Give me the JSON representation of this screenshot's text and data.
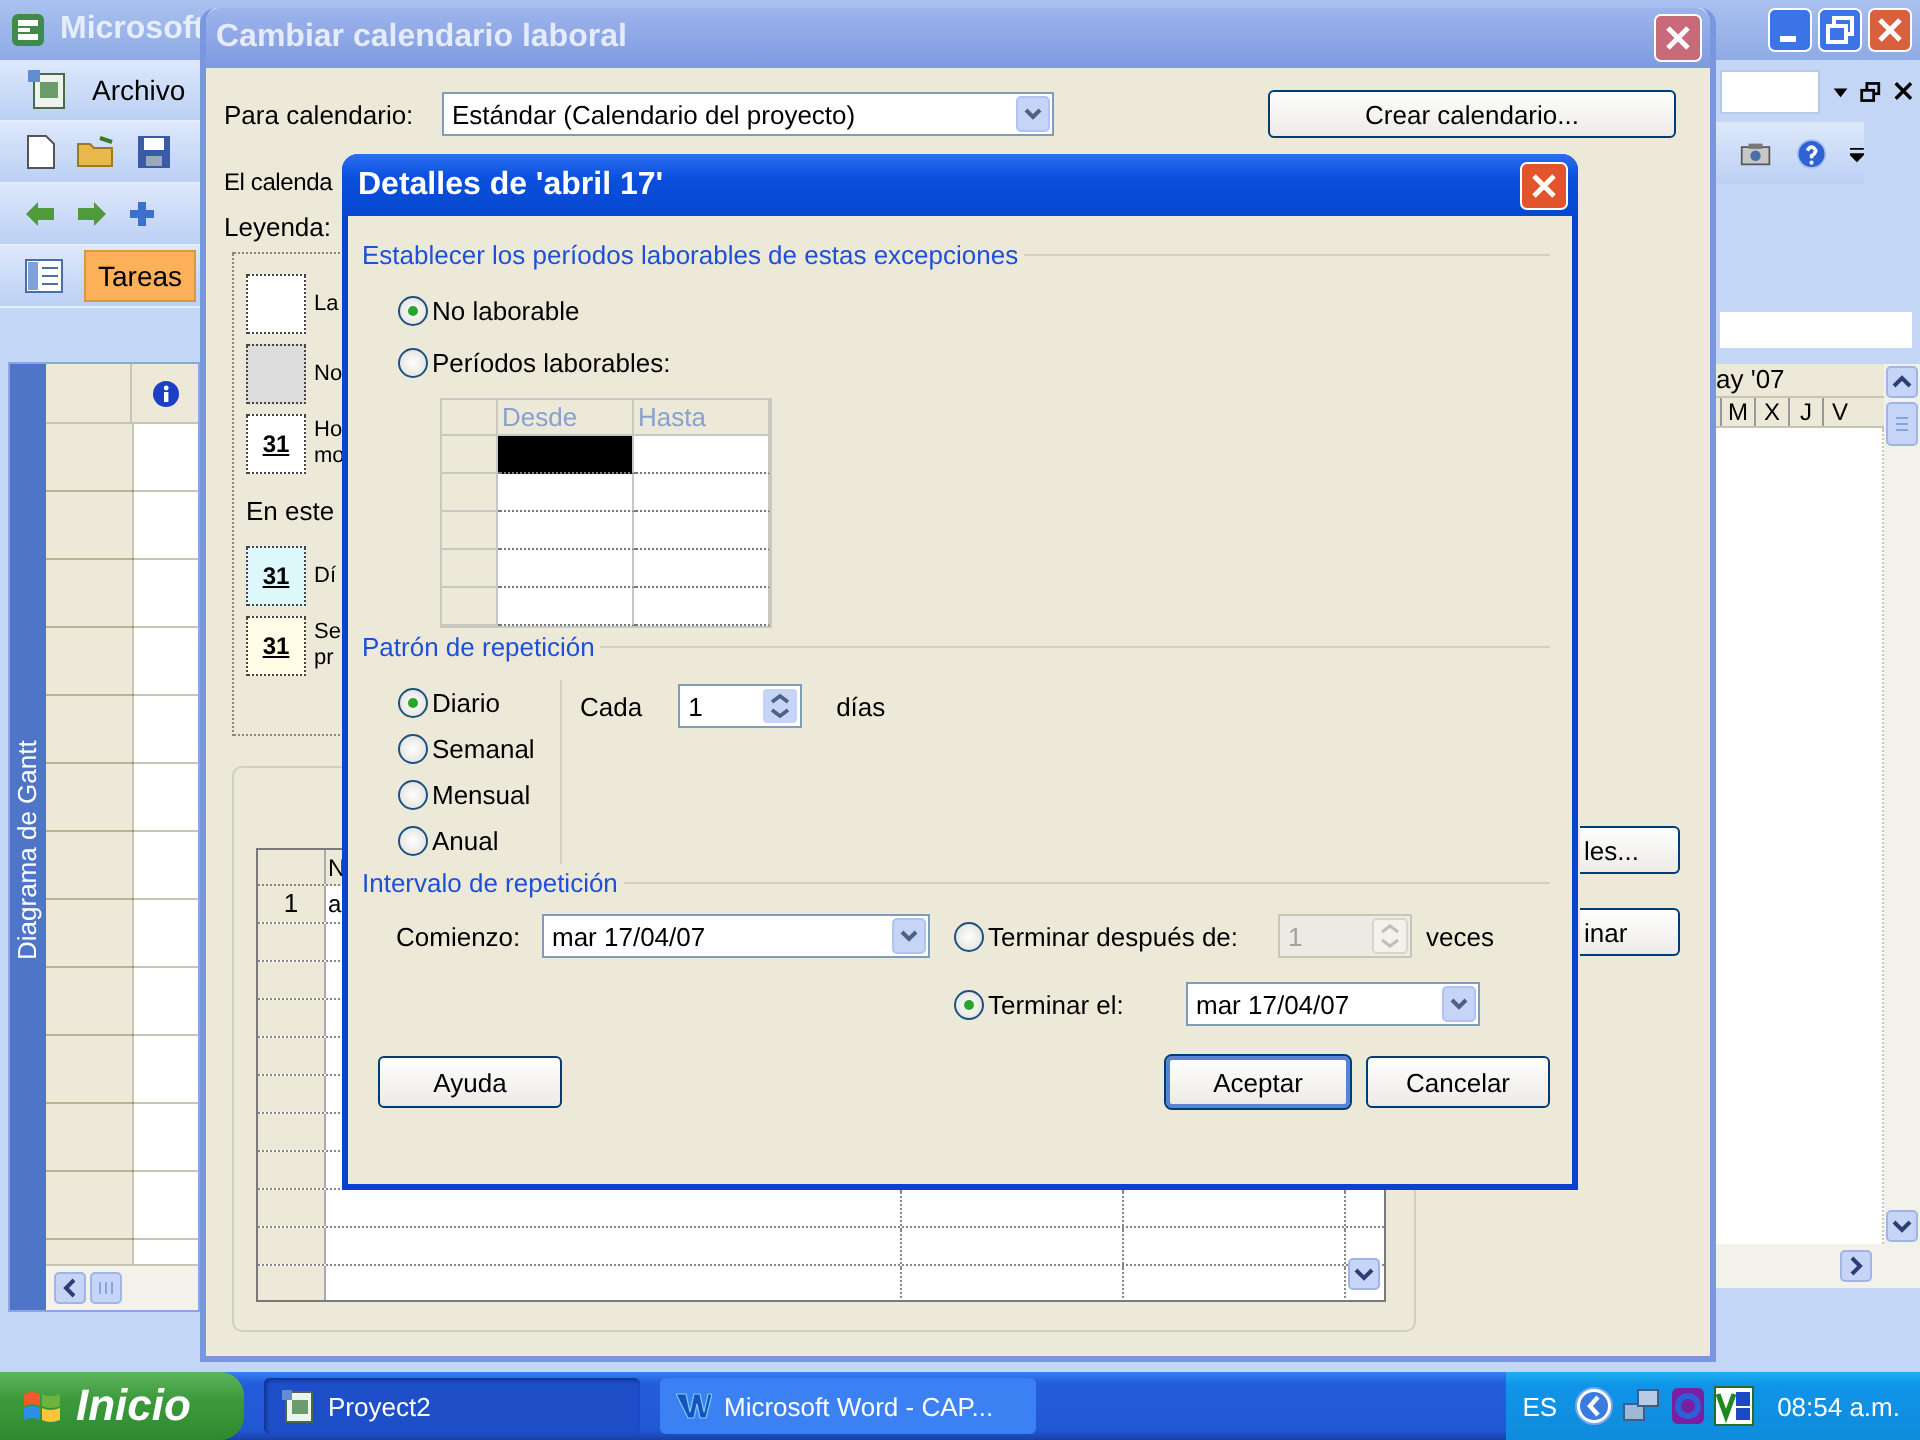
{
  "app": {
    "title": "Microsoft",
    "menu": [
      "Archivo"
    ],
    "views": [
      {
        "label": "Tareas",
        "selected": true
      }
    ],
    "side_label": "Diagrama de Gantt",
    "timescale": {
      "month": "ay '07",
      "days": [
        "M",
        "X",
        "J",
        "V"
      ]
    }
  },
  "calendar_dialog": {
    "title": "Cambiar calendario laboral",
    "calendar_label": "Para calendario:",
    "calendar_value": "Estándar (Calendario del proyecto)",
    "create_button": "Crear calendario...",
    "intro": "El calenda",
    "legend_label": "Leyenda:",
    "legend": [
      {
        "kind": "working",
        "lines": [
          "La"
        ]
      },
      {
        "kind": "nonworking",
        "lines": [
          "No"
        ]
      },
      {
        "kind": "edited",
        "number": "31",
        "lines": [
          "Ho",
          "mo"
        ]
      }
    ],
    "section_label": "En este",
    "legend_more": [
      {
        "kind": "exception",
        "number": "31",
        "lines": [
          "Dí"
        ]
      },
      {
        "kind": "nondefault",
        "number": "31",
        "lines": [
          "Se",
          "pr"
        ]
      }
    ],
    "table": {
      "column_2": "N",
      "rows": [
        [
          "1",
          "a"
        ]
      ]
    },
    "side_buttons": [
      "les...",
      "inar"
    ]
  },
  "details_dialog": {
    "title": "Detalles de 'abril 17'",
    "work_group": "Establecer los períodos laborables de estas excepciones",
    "work_options": [
      {
        "label": "No laborable",
        "selected": true
      },
      {
        "label": "Períodos laborables:",
        "selected": false
      }
    ],
    "periods": {
      "columns": [
        "Desde",
        "Hasta"
      ],
      "rows": [
        {
          "selected": true
        },
        {
          "selected": false
        },
        {
          "selected": false
        },
        {
          "selected": false
        },
        {
          "selected": false
        }
      ]
    },
    "pattern_group": "Patrón de repetición",
    "patterns": [
      {
        "label": "Diario",
        "selected": true
      },
      {
        "label": "Semanal",
        "selected": false
      },
      {
        "label": "Mensual",
        "selected": false
      },
      {
        "label": "Anual",
        "selected": false
      }
    ],
    "every_label": "Cada",
    "every_value": "1",
    "every_unit": "días",
    "range_group": "Intervalo de repetición",
    "start_label": "Comienzo:",
    "start_value": "mar 17/04/07",
    "end_options": [
      {
        "kind": "count",
        "label": "Terminar después de:",
        "selected": false,
        "value": "1",
        "disabled": true,
        "unit": "veces"
      },
      {
        "kind": "date",
        "label": "Terminar el:",
        "selected": true,
        "value": "mar 17/04/07"
      }
    ],
    "buttons": [
      {
        "label": "Ayuda",
        "default": false
      },
      {
        "label": "Aceptar",
        "default": true
      },
      {
        "label": "Cancelar",
        "default": false
      }
    ]
  },
  "taskbar": {
    "start": "Inicio",
    "tasks": [
      {
        "label": "Proyect2",
        "selected": true
      },
      {
        "label": "Microsoft Word - CAP...",
        "selected": false
      }
    ],
    "language": "ES",
    "clock": "08:54 a.m."
  }
}
